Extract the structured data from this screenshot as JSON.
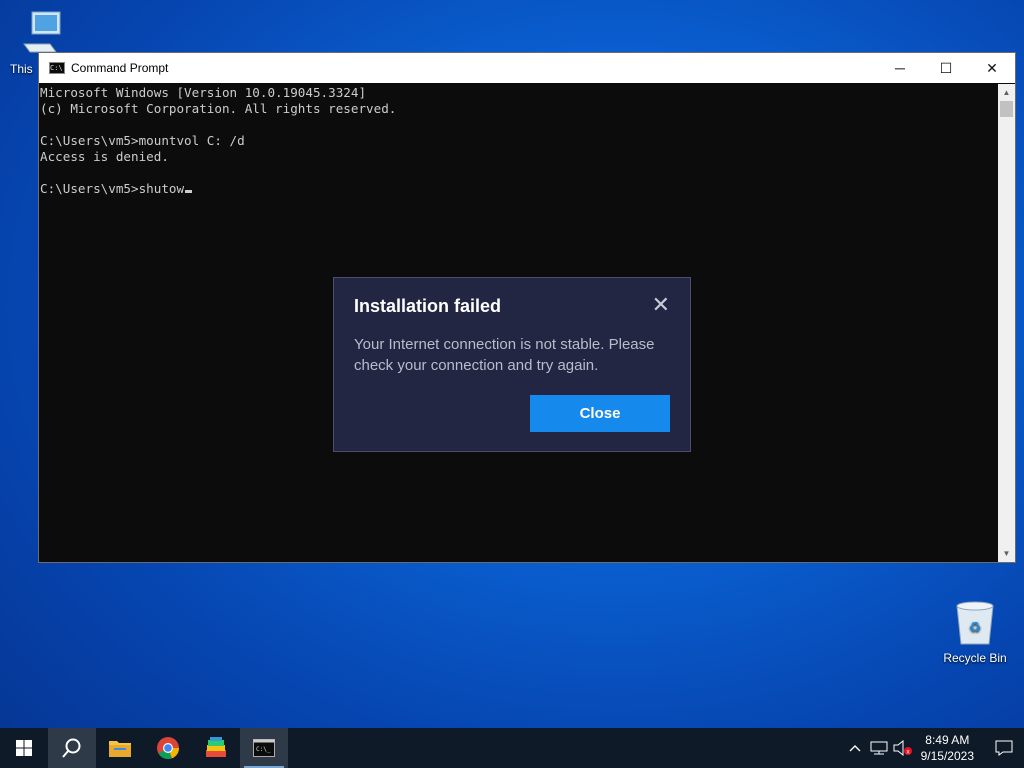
{
  "desktop": {
    "icons": [
      {
        "label": "This"
      },
      {
        "label": "Recycle Bin"
      }
    ]
  },
  "cmd_window": {
    "title": "Command Prompt",
    "buttons": {
      "minimize": "─",
      "maximize": "☐",
      "close": "✕"
    },
    "lines": [
      "Microsoft Windows [Version 10.0.19045.3324]",
      "(c) Microsoft Corporation. All rights reserved.",
      "",
      "C:\\Users\\vm5>mountvol C: /d",
      "Access is denied.",
      "",
      "C:\\Users\\vm5>shutow"
    ]
  },
  "dialog": {
    "title": "Installation failed",
    "message": "Your Internet connection is not stable. Please check your connection and try again.",
    "close_button": "Close",
    "close_icon": "✕",
    "accent": "#1689ec"
  },
  "taskbar": {
    "apps": [
      "start-icon",
      "search-icon",
      "file-explorer-icon",
      "chrome-icon",
      "bluestacks-icon",
      "command-prompt-icon"
    ],
    "clock_time": "8:49 AM",
    "clock_date": "9/15/2023"
  }
}
